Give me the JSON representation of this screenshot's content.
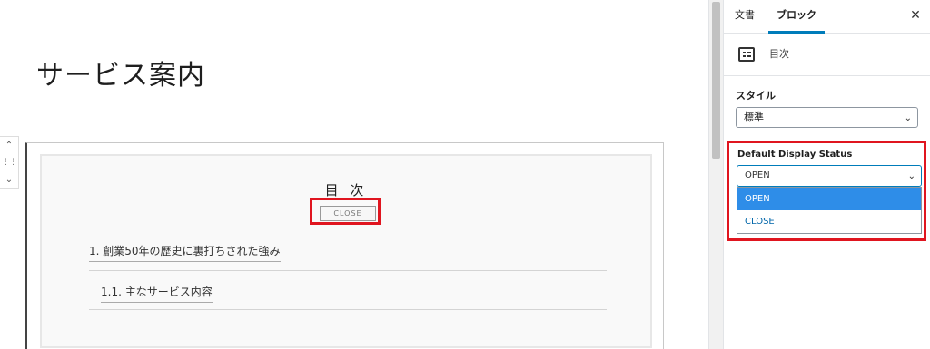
{
  "editor": {
    "page_title": "サービス案内",
    "toc": {
      "title": "目 次",
      "close_button": "CLOSE",
      "items": [
        {
          "label": "1. 創業50年の歴史に裏打ちされた強み"
        },
        {
          "label": "1.1. 主なサービス内容"
        }
      ]
    },
    "mover": {
      "up_icon": "chevron-up-icon",
      "drag_icon": "drag-handle-icon",
      "down_icon": "chevron-down-icon"
    }
  },
  "sidebar": {
    "tabs": [
      {
        "label": "文書"
      },
      {
        "label": "ブロック",
        "active": true
      }
    ],
    "close_icon": "close-icon",
    "block_card": {
      "icon": "list-view-icon",
      "name": "目次"
    },
    "style": {
      "label": "スタイル",
      "value": "標準"
    },
    "display_status": {
      "label": "Default Display Status",
      "value": "OPEN",
      "options": [
        {
          "label": "OPEN",
          "selected": true
        },
        {
          "label": "CLOSE",
          "selected": false
        }
      ]
    }
  },
  "colors": {
    "highlight_red": "#e0151f",
    "accent_blue": "#007cba",
    "selected_option_bg": "#2e8de8"
  }
}
